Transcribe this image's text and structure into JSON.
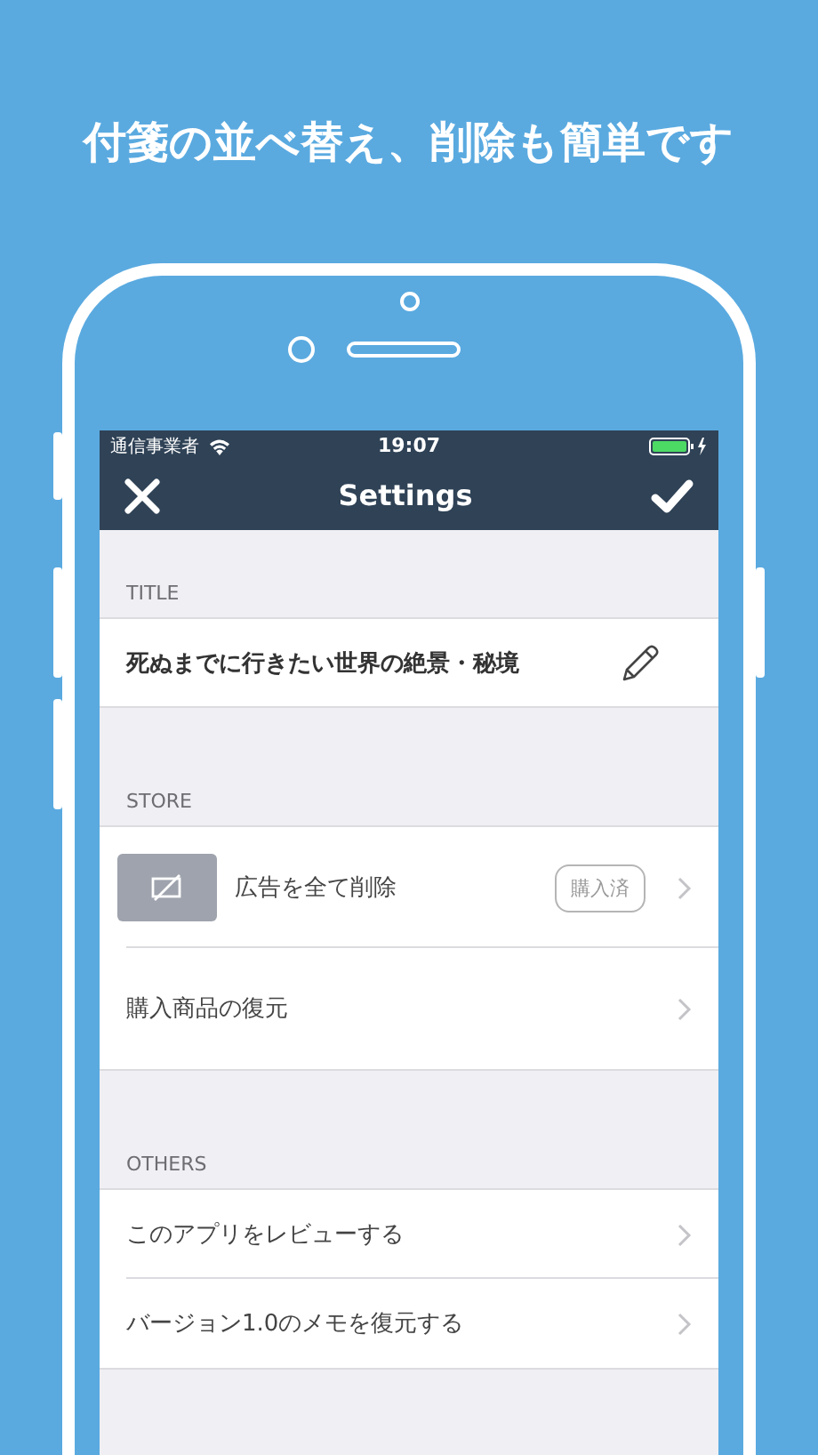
{
  "headline": "付箋の並べ替え、削除も簡単です",
  "status_bar": {
    "carrier": "通信事業者",
    "time": "19:07"
  },
  "nav": {
    "title": "Settings"
  },
  "sections": [
    {
      "header": "TITLE",
      "rows": [
        {
          "kind": "title",
          "label": "死ぬまでに行きたい世界の絶景・秘境"
        }
      ]
    },
    {
      "header": "STORE",
      "rows": [
        {
          "kind": "product",
          "label": "広告を全て削除",
          "badge": "購入済"
        },
        {
          "kind": "link",
          "label": "購入商品の復元"
        }
      ]
    },
    {
      "header": "OTHERS",
      "rows": [
        {
          "kind": "link",
          "label": "このアプリをレビューする"
        },
        {
          "kind": "link",
          "label": "バージョン1.0のメモを復元する"
        }
      ]
    }
  ]
}
